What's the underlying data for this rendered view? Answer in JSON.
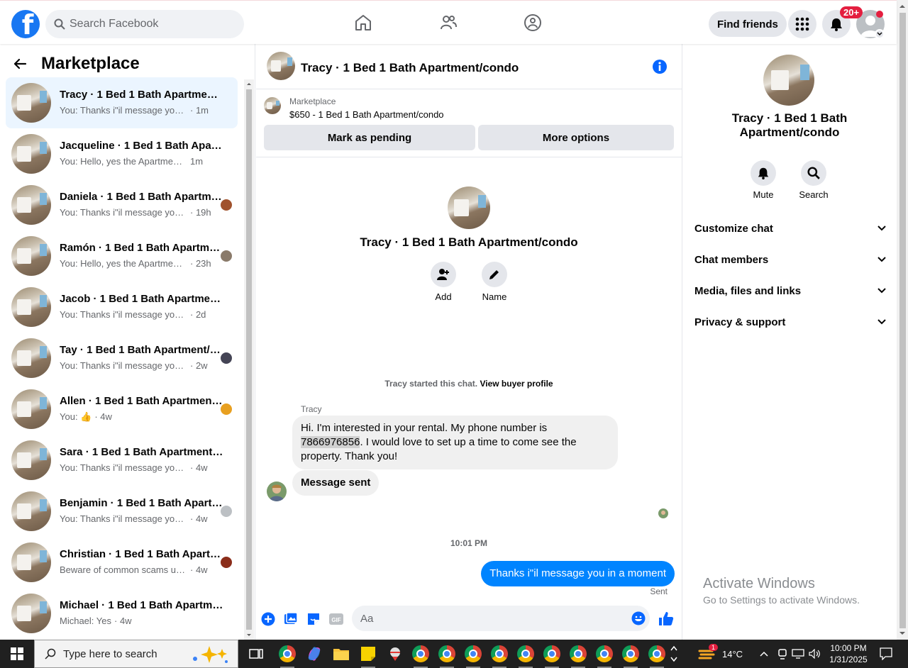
{
  "topbar": {
    "search_placeholder": "Search Facebook",
    "find_friends": "Find friends",
    "notif_count": "20+"
  },
  "left": {
    "title": "Marketplace",
    "conversations": [
      {
        "name": "Tracy · 1 Bed 1 Bath Apartment/condo",
        "preview": "You: Thanks i\"il message you in a ...",
        "time": "· 1m",
        "active": true
      },
      {
        "name": "Jacqueline · 1 Bed 1 Bath Apartment/condo",
        "preview": "You: Hello, yes the Apartment is sti...",
        "time": "1m"
      },
      {
        "name": "Daniela · 1 Bed 1 Bath Apartment/condo",
        "preview": "You: Thanks i\"il message you i...",
        "time": "· 19h"
      },
      {
        "name": "Ramón · 1 Bed 1 Bath Apartment/condo",
        "preview": "You: Hello, yes the Apartment i...",
        "time": "· 23h"
      },
      {
        "name": "Jacob · 1 Bed 1 Bath Apartment/condo",
        "preview": "You: Thanks i\"il message you in a ...",
        "time": "· 2d"
      },
      {
        "name": "Tay · 1 Bed 1 Bath Apartment/condo",
        "preview": "You: Thanks i\"il message you in ...",
        "time": "· 2w"
      },
      {
        "name": "Allen · 1 Bed 1 Bath Apartment/condo",
        "preview": "You: 👍",
        "time": "· 4w"
      },
      {
        "name": "Sara · 1 Bed 1 Bath Apartment/condo",
        "preview": "You: Thanks i\"il message you in a ...",
        "time": "· 4w"
      },
      {
        "name": "Benjamin · 1 Bed 1 Bath Apartment/condo",
        "preview": "You: Thanks i\"il message you in ...",
        "time": "· 4w"
      },
      {
        "name": "Christian · 1 Bed 1 Bath Apartment/condo",
        "preview": "Beware of common scams usin...",
        "time": "· 4w"
      },
      {
        "name": "Michael · 1 Bed 1 Bath Apartment/condo",
        "preview": "Michael: Yes",
        "time": "· 4w"
      }
    ]
  },
  "chat": {
    "title": "Tracy · 1 Bed 1 Bath Apartment/condo",
    "marketplace_label": "Marketplace",
    "listing": "$650 - 1 Bed 1 Bath Apartment/condo",
    "mark_pending": "Mark as pending",
    "more_options": "More options",
    "add_label": "Add",
    "name_label": "Name",
    "started_text": "Tracy started this chat.",
    "view_buyer": "View buyer profile",
    "sender": "Tracy",
    "msg1_a": "Hi. I'm interested in your rental. My phone number is",
    "msg1_phone": "7866976856",
    "msg1_b": ". I would love to set up a time to come see the",
    "msg1_c": "property. Thank you!",
    "msg2": "Message sent",
    "time_sep": "10:01 PM",
    "outgoing": "Thanks i\"il message you in a moment",
    "sent": "Sent",
    "composer_placeholder": "Aa"
  },
  "right": {
    "title_line1": "Tracy · 1 Bed 1 Bath",
    "title_line2": "Apartment/condo",
    "mute": "Mute",
    "search": "Search",
    "rows": [
      "Customize chat",
      "Chat members",
      "Media, files and links",
      "Privacy & support"
    ],
    "activate1": "Activate Windows",
    "activate2": "Go to Settings to activate Windows."
  },
  "taskbar": {
    "search_placeholder": "Type here to search",
    "weather": "14°C",
    "weather_badge": "1",
    "time": "10:00 PM",
    "date": "1/31/2025"
  },
  "colors": {
    "accent": "#1877f2",
    "messenger_blue": "#0084ff"
  }
}
